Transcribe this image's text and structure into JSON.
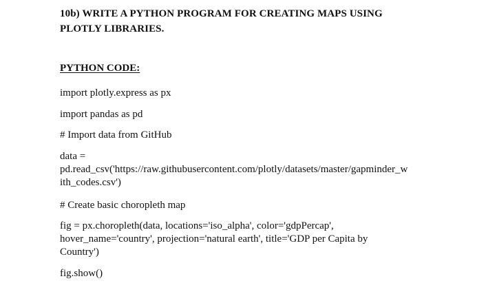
{
  "document": {
    "heading_line1": "10b) WRITE A PYTHON PROGRAM FOR CREATING MAPS USING",
    "heading_line2": "PLOTLY LIBRARIES.",
    "section_title": "PYTHON CODE:",
    "code": {
      "line1": "import plotly.express as px",
      "line2": "import pandas as pd",
      "line3": "# Import data from GitHub",
      "line4a": "data =",
      "line4b": "pd.read_csv('https://raw.githubusercontent.com/plotly/datasets/master/gapminder_w",
      "line4c": "ith_codes.csv')",
      "line5": "# Create basic choropleth map",
      "line6a": "fig = px.choropleth(data, locations='iso_alpha', color='gdpPercap',",
      "line6b": "hover_name='country', projection='natural earth', title='GDP per Capita by",
      "line6c": "Country')",
      "line7": "fig.show()"
    }
  }
}
